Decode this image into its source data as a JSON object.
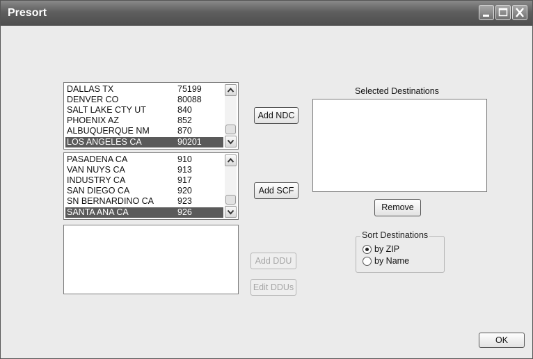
{
  "window": {
    "title": "Presort"
  },
  "ndc_list": {
    "items": [
      {
        "name": "DALLAS TX",
        "code": "75199",
        "selected": false
      },
      {
        "name": "DENVER CO",
        "code": "80088",
        "selected": false
      },
      {
        "name": "SALT LAKE CTY UT",
        "code": "840",
        "selected": false
      },
      {
        "name": "PHOENIX AZ",
        "code": "852",
        "selected": false
      },
      {
        "name": "ALBUQUERQUE NM",
        "code": "870",
        "selected": false
      },
      {
        "name": "LOS ANGELES CA",
        "code": "90201",
        "selected": true
      }
    ]
  },
  "scf_list": {
    "items": [
      {
        "name": "PASADENA CA",
        "code": "910",
        "selected": false
      },
      {
        "name": "VAN NUYS CA",
        "code": "913",
        "selected": false
      },
      {
        "name": "INDUSTRY CA",
        "code": "917",
        "selected": false
      },
      {
        "name": "SAN DIEGO CA",
        "code": "920",
        "selected": false
      },
      {
        "name": "SN BERNARDINO CA",
        "code": "923",
        "selected": false
      },
      {
        "name": "SANTA ANA CA",
        "code": "926",
        "selected": true
      }
    ]
  },
  "buttons": {
    "add_ndc": "Add NDC",
    "add_scf": "Add SCF",
    "add_ddu": "Add DDU",
    "edit_ddus": "Edit DDUs",
    "remove": "Remove",
    "ok": "OK"
  },
  "selected_destinations": {
    "label": "Selected Destinations"
  },
  "sort_destinations": {
    "title": "Sort Destinations",
    "options": [
      {
        "label": "by ZIP",
        "checked": true
      },
      {
        "label": "by Name",
        "checked": false
      }
    ]
  }
}
